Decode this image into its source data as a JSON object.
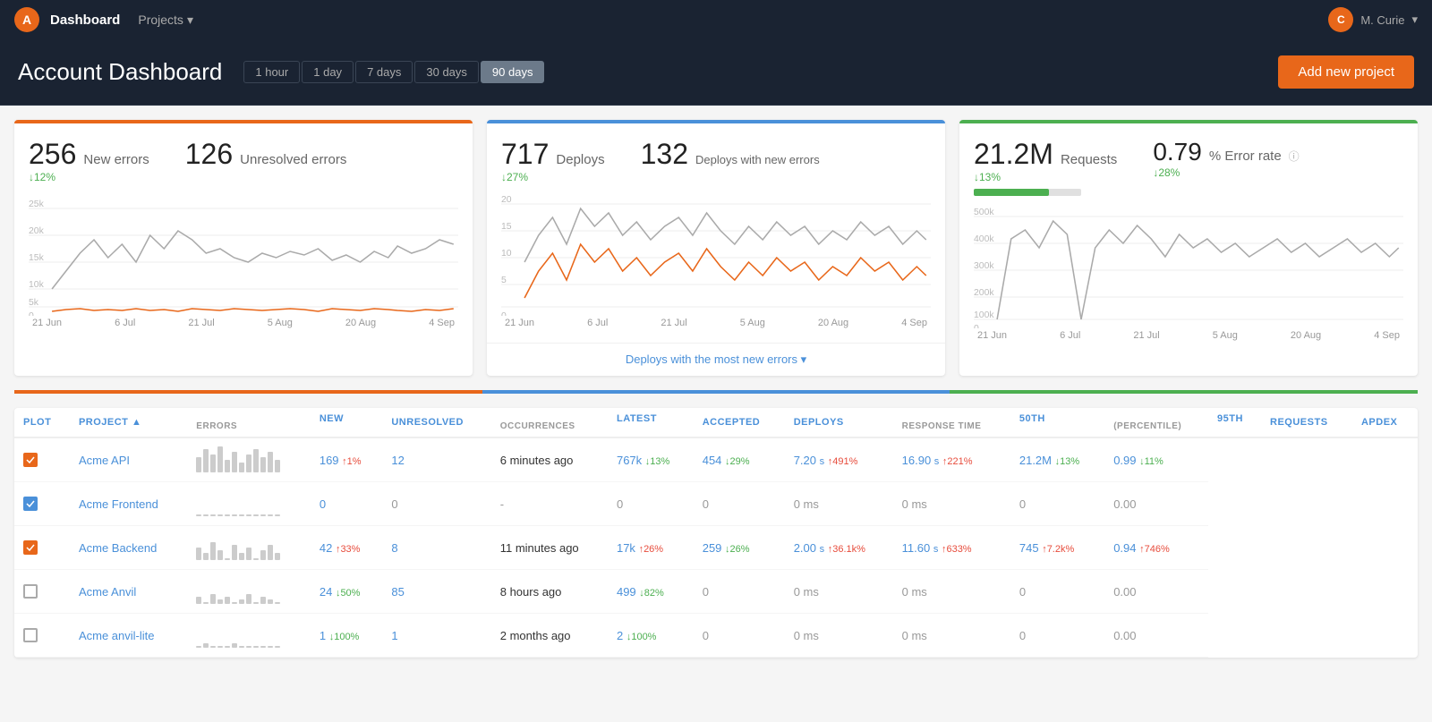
{
  "nav": {
    "logo_letter": "A",
    "title": "Dashboard",
    "projects_label": "Projects",
    "user_letter": "C",
    "user_name": "M. Curie"
  },
  "header": {
    "title": "Account Dashboard",
    "time_filters": [
      "1 hour",
      "1 day",
      "7 days",
      "30 days",
      "90 days"
    ],
    "active_filter": "90 days",
    "add_button": "Add new project"
  },
  "cards": [
    {
      "id": "errors",
      "color": "orange",
      "stats": [
        {
          "number": "256",
          "label": "New errors",
          "change": "↓12%",
          "direction": "down"
        },
        {
          "number": "126",
          "label": "Unresolved errors",
          "change": "",
          "direction": ""
        }
      ],
      "x_labels": [
        "21 Jun",
        "6 Jul",
        "21 Jul",
        "5 Aug",
        "20 Aug",
        "4 Sep"
      ],
      "footer": null
    },
    {
      "id": "deploys",
      "color": "blue",
      "stats": [
        {
          "number": "717",
          "label": "Deploys",
          "change": "↓27%",
          "direction": "down"
        },
        {
          "number": "132",
          "label": "Deploys with new errors",
          "change": "",
          "direction": ""
        }
      ],
      "x_labels": [
        "21 Jun",
        "6 Jul",
        "21 Jul",
        "5 Aug",
        "20 Aug",
        "4 Sep"
      ],
      "footer": "Deploys with the most new errors ▾"
    },
    {
      "id": "requests",
      "color": "green",
      "stats": [
        {
          "number": "21.2M",
          "label": "Requests",
          "change": "↓13%",
          "direction": "down"
        },
        {
          "number": "0.79",
          "label": "% Error rate",
          "change": "↓28%",
          "direction": "down"
        }
      ],
      "progress_bar_pct": 70,
      "x_labels": [
        "21 Jun",
        "6 Jul",
        "21 Jul",
        "5 Aug",
        "20 Aug",
        "4 Sep"
      ],
      "footer": null
    }
  ],
  "table": {
    "headers": {
      "plot": "Plot",
      "project": "Project",
      "errors_new": "New",
      "errors_unresolved": "Unresolved",
      "occurrences_latest": "Latest",
      "occurrences_accepted": "Accepted",
      "deploys": "Deploys",
      "response_50th": "50th",
      "response_95th": "95th",
      "requests": "Requests",
      "apdex": "Apdex"
    },
    "rows": [
      {
        "checked": true,
        "check_color": "orange",
        "project": "Acme API",
        "errors_new": "169",
        "errors_new_change": "↑1%",
        "errors_new_direction": "up",
        "errors_unresolved": "12",
        "occ_latest": "6 minutes ago",
        "occ_accepted": "767k",
        "occ_accepted_change": "↓13%",
        "occ_accepted_direction": "down",
        "deploys": "454",
        "deploys_change": "↓29%",
        "deploys_direction": "down",
        "resp_50": "7.20",
        "resp_50_unit": "s",
        "resp_50_change": "↑491%",
        "resp_50_direction": "up",
        "resp_95": "16.90",
        "resp_95_unit": "s",
        "resp_95_change": "↑221%",
        "resp_95_direction": "up",
        "requests": "21.2M",
        "requests_change": "↓13%",
        "requests_direction": "down",
        "apdex": "0.99",
        "apdex_change": "↓11%",
        "apdex_direction": "down",
        "bars": [
          5,
          8,
          6,
          9,
          4,
          7,
          3,
          6,
          8,
          5,
          7,
          4
        ]
      },
      {
        "checked": true,
        "check_color": "blue",
        "project": "Acme Frontend",
        "errors_new": "0",
        "errors_new_change": "",
        "errors_new_direction": "",
        "errors_unresolved": "0",
        "occ_latest": "-",
        "occ_accepted": "0",
        "occ_accepted_change": "",
        "occ_accepted_direction": "",
        "deploys": "0",
        "deploys_change": "",
        "deploys_direction": "",
        "resp_50": "0",
        "resp_50_unit": "ms",
        "resp_50_change": "",
        "resp_50_direction": "",
        "resp_95": "0",
        "resp_95_unit": "ms",
        "resp_95_change": "",
        "resp_95_direction": "",
        "requests": "0",
        "requests_change": "",
        "requests_direction": "",
        "apdex": "0.00",
        "apdex_change": "",
        "apdex_direction": "",
        "bars": [
          0,
          0,
          0,
          0,
          0,
          0,
          0,
          0,
          0,
          0,
          0,
          0
        ]
      },
      {
        "checked": true,
        "check_color": "orange",
        "project": "Acme Backend",
        "errors_new": "42",
        "errors_new_change": "↑33%",
        "errors_new_direction": "up",
        "errors_unresolved": "8",
        "occ_latest": "11 minutes ago",
        "occ_accepted": "17k",
        "occ_accepted_change": "↑26%",
        "occ_accepted_direction": "up",
        "deploys": "259",
        "deploys_change": "↓26%",
        "deploys_direction": "down",
        "resp_50": "2.00",
        "resp_50_unit": "s",
        "resp_50_change": "↑36.1k%",
        "resp_50_direction": "up",
        "resp_95": "11.60",
        "resp_95_unit": "s",
        "resp_95_change": "↑633%",
        "resp_95_direction": "up",
        "requests": "745",
        "requests_change": "↑7.2k%",
        "requests_direction": "up",
        "apdex": "0.94",
        "apdex_change": "↑746%",
        "apdex_direction": "up",
        "bars": [
          4,
          2,
          6,
          3,
          0,
          5,
          2,
          4,
          0,
          3,
          5,
          2
        ]
      },
      {
        "checked": false,
        "check_color": "",
        "project": "Acme Anvil",
        "errors_new": "24",
        "errors_new_change": "↓50%",
        "errors_new_direction": "down",
        "errors_unresolved": "85",
        "occ_latest": "8 hours ago",
        "occ_accepted": "499",
        "occ_accepted_change": "↓82%",
        "occ_accepted_direction": "down",
        "deploys": "0",
        "deploys_change": "",
        "deploys_direction": "",
        "resp_50": "0",
        "resp_50_unit": "ms",
        "resp_50_change": "",
        "resp_50_direction": "",
        "resp_95": "0",
        "resp_95_unit": "ms",
        "resp_95_change": "",
        "resp_95_direction": "",
        "requests": "0",
        "requests_change": "",
        "requests_direction": "",
        "apdex": "0.00",
        "apdex_change": "",
        "apdex_direction": "",
        "bars": [
          2,
          0,
          3,
          1,
          2,
          0,
          1,
          3,
          0,
          2,
          1,
          0
        ]
      },
      {
        "checked": false,
        "check_color": "",
        "project": "Acme anvil-lite",
        "errors_new": "1",
        "errors_new_change": "↓100%",
        "errors_new_direction": "down",
        "errors_unresolved": "1",
        "occ_latest": "2 months ago",
        "occ_accepted": "2",
        "occ_accepted_change": "↓100%",
        "occ_accepted_direction": "down",
        "deploys": "0",
        "deploys_change": "",
        "deploys_direction": "",
        "resp_50": "0",
        "resp_50_unit": "ms",
        "resp_50_change": "",
        "resp_50_direction": "",
        "resp_95": "0",
        "resp_95_unit": "ms",
        "resp_95_change": "",
        "resp_95_direction": "",
        "requests": "0",
        "requests_change": "",
        "requests_direction": "",
        "apdex": "0.00",
        "apdex_change": "",
        "apdex_direction": "",
        "bars": [
          0,
          1,
          0,
          0,
          0,
          1,
          0,
          0,
          0,
          0,
          0,
          0
        ]
      }
    ]
  }
}
